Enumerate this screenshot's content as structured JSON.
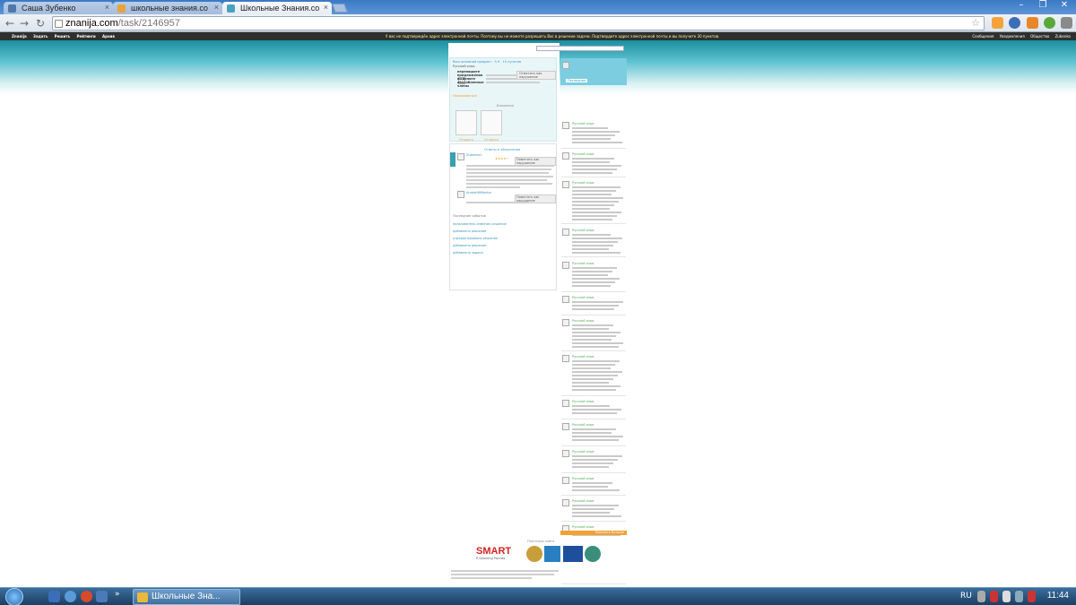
{
  "window": {
    "tabs": [
      {
        "label": "Саша Зубенко",
        "icon_color": "#4d79a8"
      },
      {
        "label": "школьные знания.co",
        "icon_color": "#e8a33a"
      },
      {
        "label": "Школьные Знания.co",
        "icon_color": "#4aa0c0",
        "active": true
      }
    ]
  },
  "toolbar": {
    "url_host": "znanija.com",
    "url_path": "/task/2146957",
    "extension_icons": [
      "thumbs-up-icon",
      "alert-badge-icon",
      "notification-icon",
      "puzzle-icon",
      "wrench-icon"
    ]
  },
  "site": {
    "topbar_left": [
      "Znanija",
      "Задать",
      "Решить",
      "Рейтинги",
      "Архив"
    ],
    "topbar_center": "У вас не подтверждён адрес электронной почты. Поэтому вы не можете разрешить Вас в решении задачи. Подтвердите адрес электронной почты и вы получите 30 пунктов.",
    "topbar_right": [
      "Сообщения",
      "Уведомления",
      "Общество",
      "Zubenko"
    ],
    "logo": "znanija.com",
    "logo_sub": "Учимся вместе",
    "question": {
      "meta": "Ваш основной предмет · 5-9 · 10 пунктов",
      "subject": "Русский язык",
      "text": "перепишите предложения выделите обособленные члены",
      "actions": [
        "Пожаловаться",
        "Отметить как нарушение"
      ],
      "attachments_label": "Вложения",
      "attachments": [
        "Открыть",
        "Открыть"
      ]
    },
    "answers_label": "Ответы и объяснения",
    "answers": [
      {
        "author": "Zubenko1",
        "stars": "★★★★☆",
        "action": "Пометить как нарушение"
      },
      {
        "author": "Andrei98Mentor",
        "action": "Пометить как нарушение"
      }
    ],
    "history_label": "Последние события",
    "history": [
      "пользователь изменил решение",
      "добавлено решение",
      "отредактировано решение",
      "добавлено решение",
      "добавлена задача"
    ],
    "side_label": "Последние",
    "side_cards": [
      "Русский язык",
      "Русский язык",
      "Русский язык",
      "Русский язык",
      "Русский язык",
      "Русский язык",
      "Русский язык",
      "Русский язык",
      "Русский язык",
      "Русский язык",
      "Русский язык",
      "Русский язык",
      "Русский язык",
      "Русский язык",
      "Русский язык",
      "Русский язык",
      "Русский язык"
    ],
    "side_more": "Показать больше",
    "partners_label": "Партнеры сайта",
    "partner_smart": "SMART",
    "partner_smart_sub": "E-Learning Россия"
  },
  "taskbar": {
    "app_label": "Школьные Зна...",
    "lang": "RU",
    "clock": "11:44"
  }
}
